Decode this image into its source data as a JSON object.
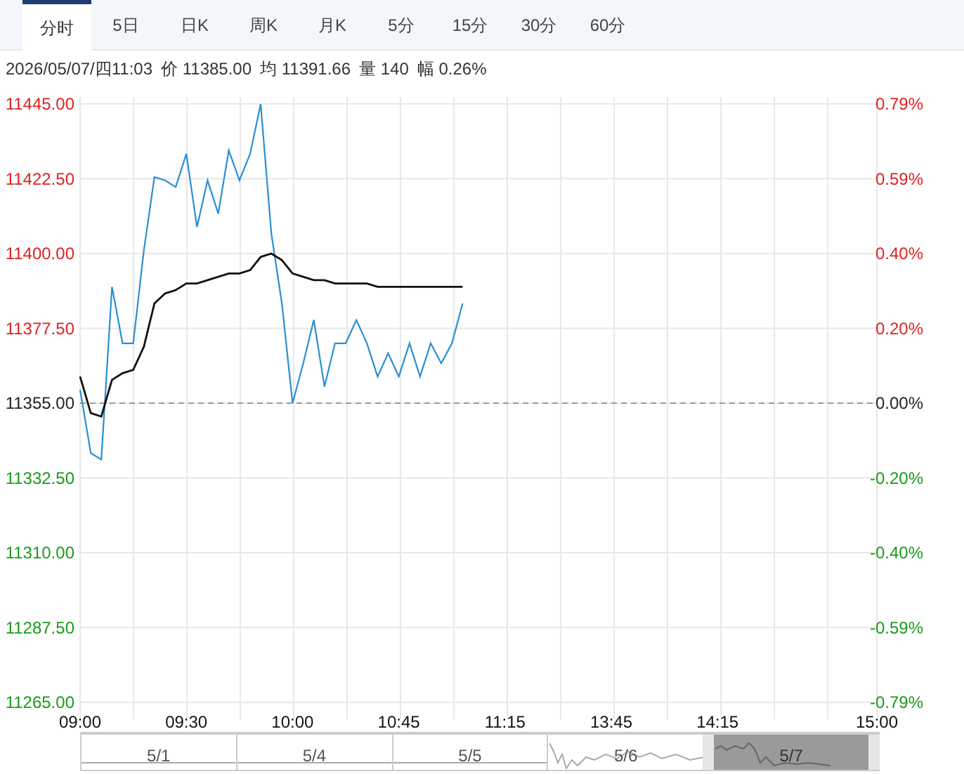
{
  "tabs": [
    {
      "label": "分时",
      "selected": true
    },
    {
      "label": "5日",
      "selected": false
    },
    {
      "label": "日K",
      "selected": false
    },
    {
      "label": "周K",
      "selected": false
    },
    {
      "label": "月K",
      "selected": false
    },
    {
      "label": "5分",
      "selected": false
    },
    {
      "label": "15分",
      "selected": false
    },
    {
      "label": "30分",
      "selected": false
    },
    {
      "label": "60分",
      "selected": false
    }
  ],
  "quote_line": [
    "2026/05/07/四11:03",
    "价 11385.00",
    "均 11391.66",
    "量 140",
    "幅 0.26%"
  ],
  "chart": {
    "chart_data": {
      "type": "line",
      "grid": true,
      "ylim": [
        11265,
        11445
      ],
      "categories": [
        "09:00",
        null,
        null,
        null,
        null,
        null,
        null,
        null,
        null,
        null,
        "09:30",
        null,
        null,
        null,
        null,
        null,
        null,
        null,
        null,
        null,
        "10:00",
        null,
        null,
        null,
        null,
        null,
        null,
        null,
        null,
        null,
        "10:45",
        null,
        null,
        null,
        null,
        null,
        null,
        null,
        null,
        null,
        "11:15",
        null,
        null,
        null,
        null,
        null,
        null,
        null,
        null,
        null,
        "13:45",
        null,
        null,
        null,
        null,
        null,
        null,
        null,
        null,
        null,
        "14:15",
        null,
        null,
        null,
        null,
        null,
        null,
        null,
        null,
        null,
        null,
        null,
        null,
        null,
        null,
        "15:00"
      ],
      "yticks": [
        {
          "value": 11445,
          "label": "11445.00"
        },
        {
          "value": 11422.5,
          "label": "11422.50"
        },
        {
          "value": 11400,
          "label": "11400.00"
        },
        {
          "value": 11377.5,
          "label": "11377.50"
        },
        {
          "value": 11355,
          "label": "11355.00"
        },
        {
          "value": 11332.5,
          "label": "11332.50"
        },
        {
          "value": 11310,
          "label": "11310.00"
        },
        {
          "value": 11287.5,
          "label": "11287.50"
        },
        {
          "value": 11265,
          "label": "11265.00"
        }
      ],
      "series": [
        {
          "color": "#2b8fd0",
          "values": [
            11359,
            11340,
            11338,
            11390,
            11373,
            11373,
            11401,
            11423,
            11422,
            11420,
            11430,
            11408,
            11422,
            11412,
            11431,
            11422,
            11430,
            11445,
            11406,
            11385,
            11355,
            11367,
            11380,
            11360,
            11373,
            11373,
            11380,
            11373,
            11363,
            11370,
            11363,
            11373,
            11363,
            11373,
            11367,
            11373,
            11385,
            null,
            null,
            null,
            null,
            null,
            null,
            null,
            null,
            null,
            null,
            null,
            null,
            null,
            null,
            null,
            null,
            null,
            null,
            null,
            null,
            null,
            null,
            null,
            null,
            null,
            null,
            null,
            null,
            null,
            null,
            null,
            null,
            null,
            null,
            null,
            null,
            null,
            null,
            null
          ]
        },
        {
          "color": "#111111",
          "values": [
            11363,
            11352,
            11351,
            11362,
            11364,
            11365,
            11372,
            11385,
            11388,
            11389,
            11391,
            11391,
            11392,
            11393,
            11394,
            11394,
            11395,
            11399,
            11400,
            11398,
            11394,
            11393,
            11392,
            11392,
            11391,
            11391,
            11391,
            11391,
            11390,
            11390,
            11390,
            11390,
            11390,
            11390,
            11390,
            11390,
            11390,
            null,
            null,
            null,
            null,
            null,
            null,
            null,
            null,
            null,
            null,
            null,
            null,
            null,
            null,
            null,
            null,
            null,
            null,
            null,
            null,
            null,
            null,
            null,
            null,
            null,
            null,
            null,
            null,
            null,
            null,
            null,
            null,
            null,
            null,
            null,
            null,
            null,
            null,
            null
          ]
        }
      ],
      "ref_lines": [
        {
          "axis": "y",
          "value": 11355
        }
      ]
    },
    "right_axis": [
      {
        "label": "0.79%",
        "kind": "up"
      },
      {
        "label": "0.59%",
        "kind": "up"
      },
      {
        "label": "0.40%",
        "kind": "up"
      },
      {
        "label": "0.20%",
        "kind": "up"
      },
      {
        "label": "0.00%",
        "kind": "flat"
      },
      {
        "label": "-0.20%",
        "kind": "down"
      },
      {
        "label": "-0.40%",
        "kind": "down"
      },
      {
        "label": "-0.59%",
        "kind": "down"
      },
      {
        "label": "-0.79%",
        "kind": "down"
      }
    ]
  },
  "navigator": [
    {
      "date": "5/1",
      "kind": "flat",
      "selected": false
    },
    {
      "date": "5/4",
      "kind": "flat",
      "selected": false
    },
    {
      "date": "5/5",
      "kind": "flat",
      "selected": false
    },
    {
      "date": "5/6",
      "kind": "sparkline",
      "selected": false
    },
    {
      "date": "5/7",
      "kind": "sparkline",
      "selected": true
    }
  ]
}
